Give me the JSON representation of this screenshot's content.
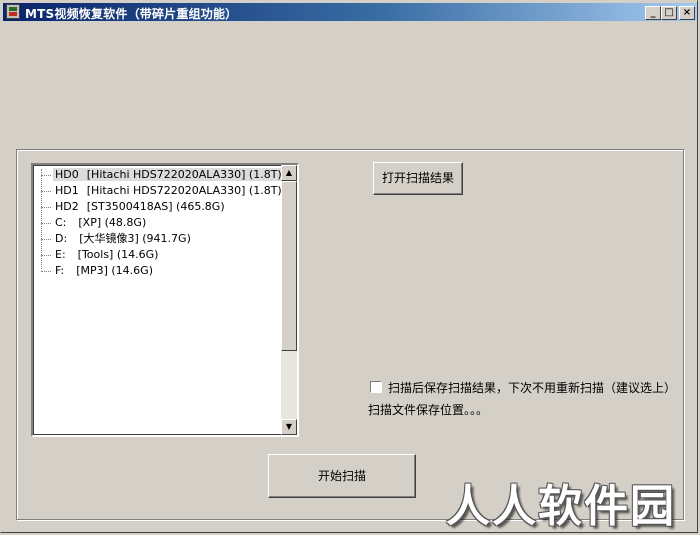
{
  "window": {
    "title": "MTS视频恢复软件（带碎片重组功能）",
    "minimize_glyph": "_",
    "maximize_glyph": "□",
    "close_glyph": "×"
  },
  "drive_tree": {
    "items": [
      {
        "name": "HD0",
        "detail": "[Hitachi HDS722020ALA330] (1.8T)",
        "selected": true
      },
      {
        "name": "HD1",
        "detail": "[Hitachi HDS722020ALA330] (1.8T)"
      },
      {
        "name": "HD2",
        "detail": "[ST3500418AS] (465.8G)"
      },
      {
        "name": "C:",
        "detail": "[XP] (48.8G)"
      },
      {
        "name": "D:",
        "detail": "[大华镜像3] (941.7G)"
      },
      {
        "name": "E:",
        "detail": "[Tools] (14.6G)"
      },
      {
        "name": "F:",
        "detail": "[MP3] (14.6G)"
      }
    ],
    "scroll_up_glyph": "▲",
    "scroll_down_glyph": "▼"
  },
  "buttons": {
    "open_scan_results": "打开扫描结果",
    "start_scan": "开始扫描"
  },
  "options": {
    "save_scan_results_label": "扫描后保存扫描结果，下次不用重新扫描（建议选上）",
    "save_scan_results_checked": false,
    "save_location_label": "扫描文件保存位置。。。"
  },
  "watermark": "人人软件园"
}
